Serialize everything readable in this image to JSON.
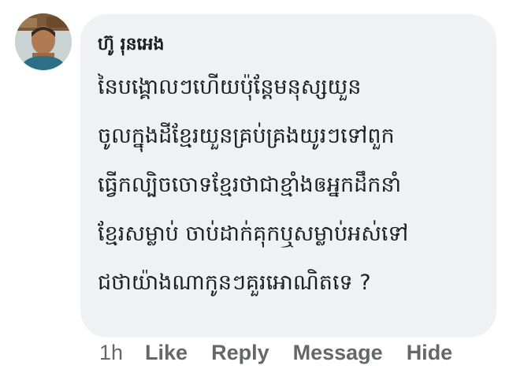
{
  "comment": {
    "author": "ហ៊ូ រុនអេង",
    "lines": [
      "នៃបង្គោលៗហើយប៉ុន្តែមនុស្សយួន",
      "ចូលក្នុងដីខ្មែរយួនគ្រប់គ្រងយូរៗទៅពួក",
      "ធ្វើកល្បិចចោទខ្មែរថាជាខ្មាំងឲអ្នកដឹកនាំ",
      "ខ្មែរសម្លាប់ ចាប់ដាក់គុកឬសម្លាប់អស់ទៅ",
      "ជថាយ៉ាងណាកូនៗគួរអោណិតទេ ?"
    ]
  },
  "actions": {
    "time": "1h",
    "like": "Like",
    "reply": "Reply",
    "message": "Message",
    "hide": "Hide"
  },
  "colors": {
    "bubble": "#f0f1f4",
    "text": "#1c1e21",
    "meta": "#65676b"
  }
}
